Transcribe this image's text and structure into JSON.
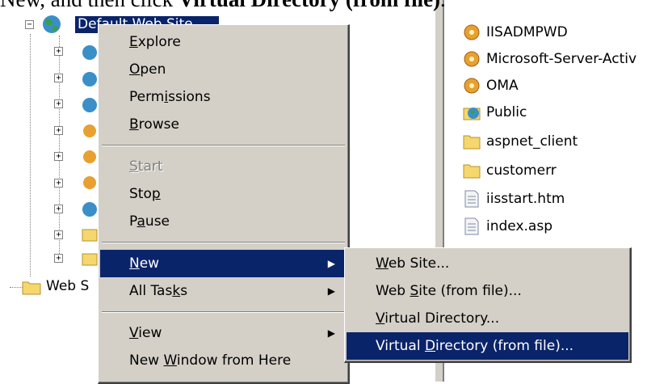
{
  "caption": {
    "prefix": "New, and then click ",
    "bold": "Virtual Directory (from file)",
    "suffix": "."
  },
  "tree": {
    "root_label": "Default Web Site",
    "web_sites_label": "Web S"
  },
  "right_panel": {
    "items": [
      {
        "label": "IISADMPWD",
        "icon": "gear-folder-icon"
      },
      {
        "label": "Microsoft-Server-Activ",
        "icon": "gear-folder-icon"
      },
      {
        "label": "OMA",
        "icon": "gear-folder-icon"
      },
      {
        "label": "Public",
        "icon": "globe-folder-icon"
      },
      {
        "label": "aspnet_client",
        "icon": "folder-icon"
      },
      {
        "label": "customerr",
        "icon": "folder-icon"
      },
      {
        "label": "iisstart.htm",
        "icon": "file-icon"
      },
      {
        "label": "index.asp",
        "icon": "file-icon"
      }
    ]
  },
  "context_menu": {
    "explore": {
      "pre": "",
      "u": "E",
      "post": "xplore"
    },
    "open": {
      "pre": "",
      "u": "O",
      "post": "pen"
    },
    "permissions": {
      "pre": "Perm",
      "u": "i",
      "post": "ssions"
    },
    "browse": {
      "pre": "",
      "u": "B",
      "post": "rowse"
    },
    "start": {
      "pre": "",
      "u": "S",
      "post": "tart"
    },
    "stop": {
      "pre": "Sto",
      "u": "p",
      "post": ""
    },
    "pause": {
      "pre": "P",
      "u": "a",
      "post": "use"
    },
    "new": {
      "pre": "",
      "u": "N",
      "post": "ew"
    },
    "all_tasks": {
      "pre": "All Tas",
      "u": "k",
      "post": "s"
    },
    "view": {
      "pre": "",
      "u": "V",
      "post": "iew"
    },
    "new_window": {
      "pre": "New ",
      "u": "W",
      "post": "indow from Here"
    }
  },
  "submenu": {
    "web_site": {
      "pre": "",
      "u": "W",
      "post": "eb Site..."
    },
    "web_site_file": {
      "pre": "Web ",
      "u": "S",
      "post": "ite (from file)..."
    },
    "virtual_dir": {
      "pre": "",
      "u": "V",
      "post": "irtual Directory..."
    },
    "virtual_dir_file": {
      "pre": "Virtual ",
      "u": "D",
      "post": "irectory (from file)..."
    }
  },
  "colors": {
    "highlight": "#0a246a",
    "menu_face": "#d4d0c8",
    "disabled": "#808080"
  }
}
